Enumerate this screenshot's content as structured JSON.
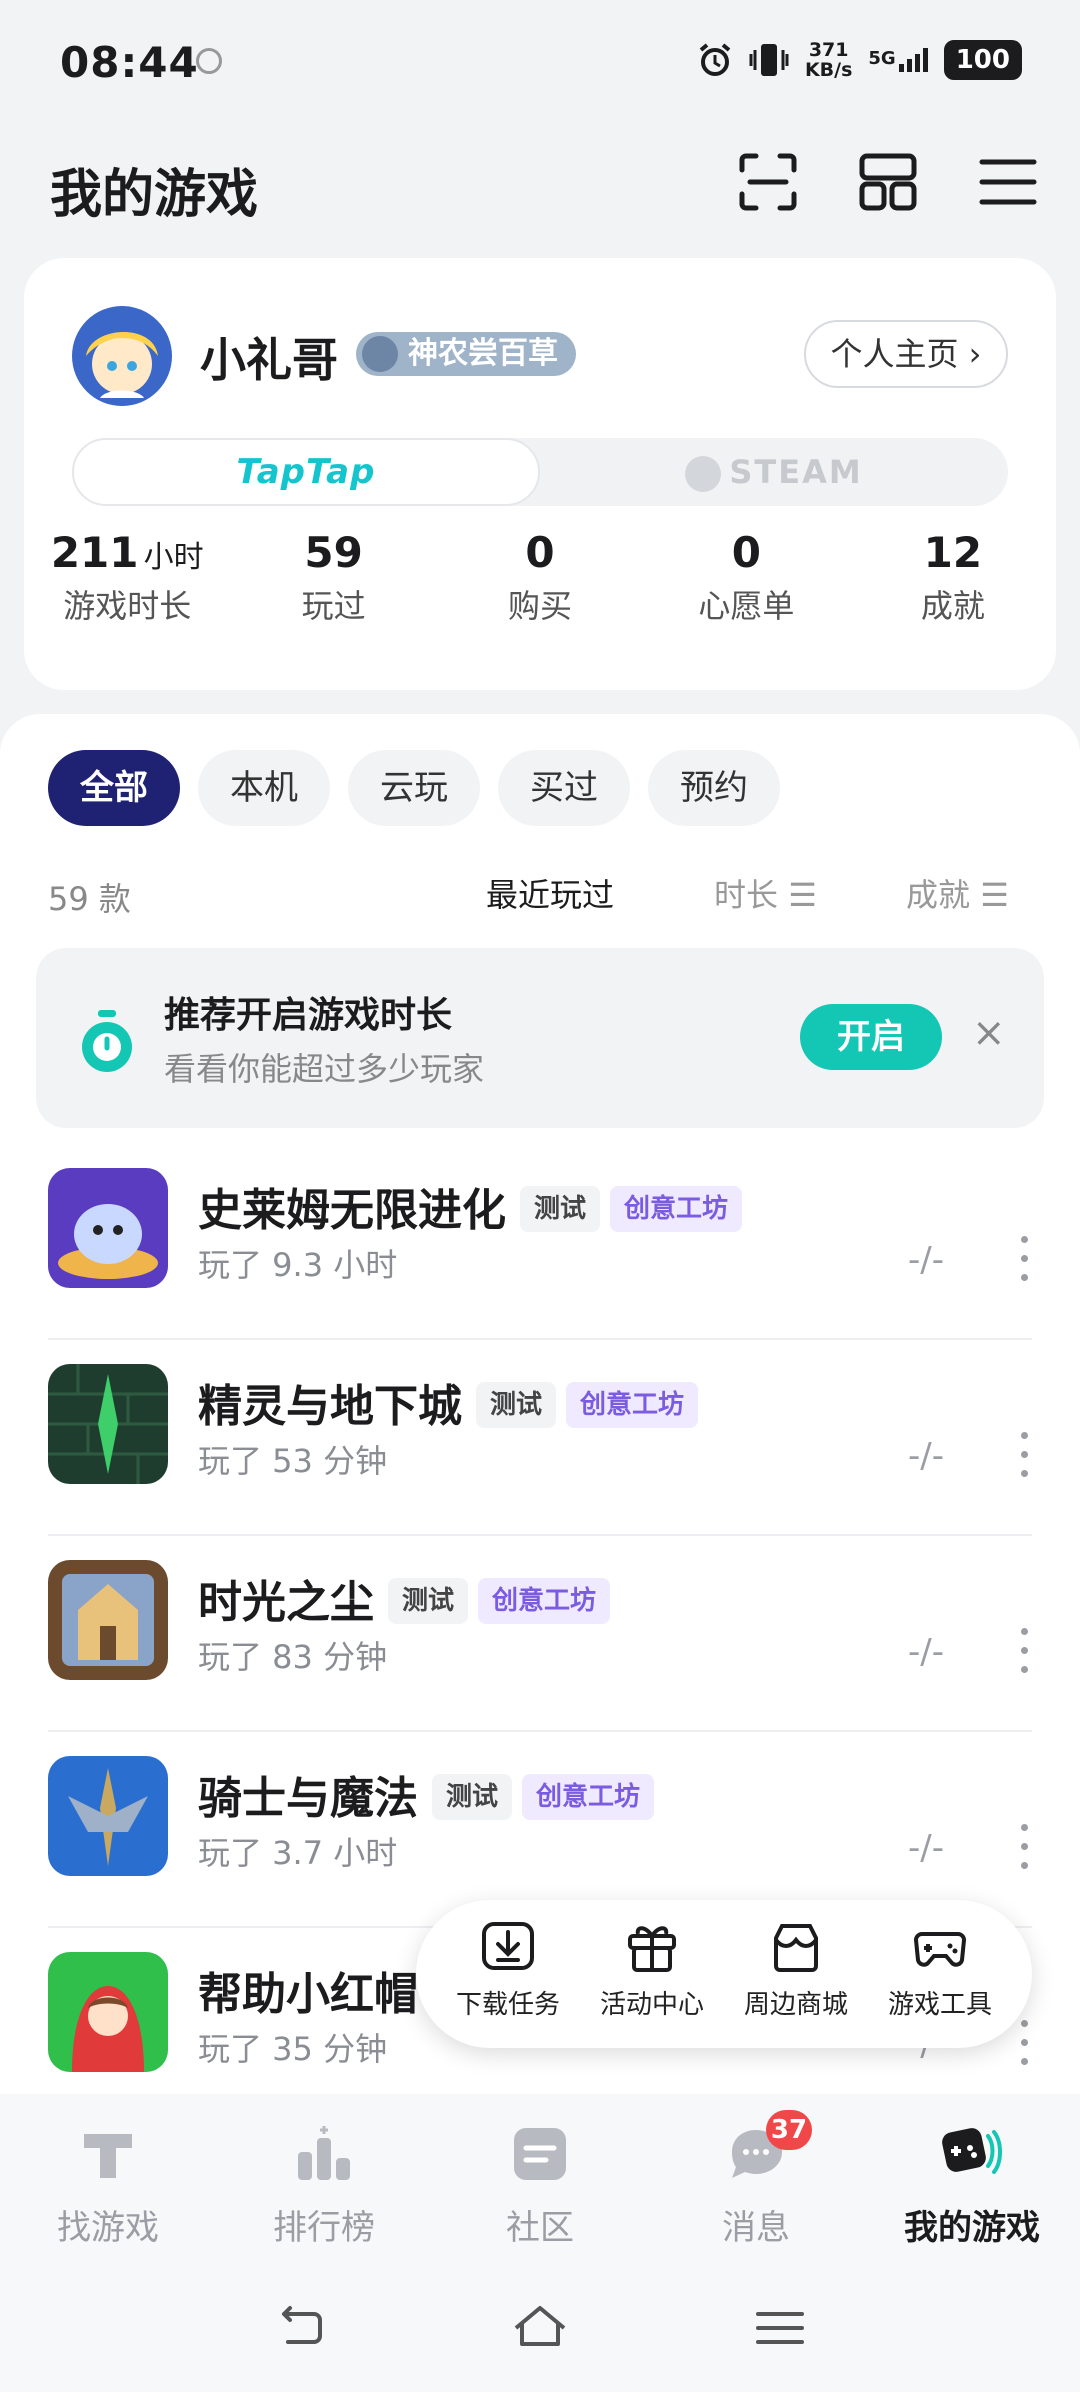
{
  "status_bar": {
    "time": "08:44",
    "net_speed_value": "371",
    "net_speed_unit": "KB/s",
    "network": "5G",
    "battery": "100"
  },
  "header": {
    "title": "我的游戏",
    "icons": [
      "scan-icon",
      "grid-icon",
      "menu-icon"
    ]
  },
  "profile": {
    "name": "小礼哥",
    "badge": "神农尝百草",
    "homepage_button": "个人主页 ›",
    "platforms": {
      "active": "TapTap",
      "inactive": "STEAM"
    },
    "stats": [
      {
        "value": "211",
        "unit": "小时",
        "label": "游戏时长"
      },
      {
        "value": "59",
        "unit": "",
        "label": "玩过"
      },
      {
        "value": "0",
        "unit": "",
        "label": "购买"
      },
      {
        "value": "0",
        "unit": "",
        "label": "心愿单"
      },
      {
        "value": "12",
        "unit": "",
        "label": "成就"
      }
    ]
  },
  "filters": {
    "chips": [
      "全部",
      "本机",
      "云玩",
      "买过",
      "预约"
    ],
    "active": "全部",
    "count": "59 款",
    "sort": [
      "最近玩过",
      "时长",
      "成就"
    ],
    "sort_active": "最近玩过"
  },
  "recommendation": {
    "title": "推荐开启游戏时长",
    "subtitle": "看看你能超过多少玩家",
    "button": "开启",
    "close": "×"
  },
  "games": [
    {
      "title": "史莱姆无限进化",
      "tags": [
        "测试",
        "创意工坊"
      ],
      "played": "玩了 9.3 小时",
      "score": "-/-",
      "icon_colors": [
        "#6a4ad0",
        "#ffd36a"
      ]
    },
    {
      "title": "精灵与地下城",
      "tags": [
        "测试",
        "创意工坊"
      ],
      "played": "玩了 53 分钟",
      "score": "-/-",
      "icon_colors": [
        "#1f3d2e",
        "#3ecf6a"
      ]
    },
    {
      "title": "时光之尘",
      "tags": [
        "测试",
        "创意工坊"
      ],
      "played": "玩了 83 分钟",
      "score": "-/-",
      "icon_colors": [
        "#6b4a2e",
        "#e8c27a"
      ]
    },
    {
      "title": "骑士与魔法",
      "tags": [
        "测试",
        "创意工坊"
      ],
      "played": "玩了 3.7 小时",
      "score": "-/-",
      "icon_colors": [
        "#2a6fd0",
        "#c9a860"
      ]
    },
    {
      "title": "帮助小红帽",
      "tags": [],
      "played": "玩了 35 分钟",
      "score": "-/-",
      "icon_colors": [
        "#2fbf4a",
        "#e03a3a"
      ]
    }
  ],
  "quick_menu": [
    {
      "label": "下载任务",
      "icon": "download-icon"
    },
    {
      "label": "活动中心",
      "icon": "gift-icon"
    },
    {
      "label": "周边商城",
      "icon": "shop-icon"
    },
    {
      "label": "游戏工具",
      "icon": "gamepad-icon"
    }
  ],
  "tabs": [
    {
      "label": "找游戏",
      "icon": "taptap-icon"
    },
    {
      "label": "排行榜",
      "icon": "ranking-icon"
    },
    {
      "label": "社区",
      "icon": "community-icon"
    },
    {
      "label": "消息",
      "icon": "message-icon",
      "badge": "37"
    },
    {
      "label": "我的游戏",
      "icon": "mygames-icon",
      "active": true
    }
  ],
  "colors": {
    "accent_teal": "#14c7b4",
    "chip_active": "#1f2272",
    "workshop_purple": "#7b5ce0",
    "badge_red": "#f04848"
  }
}
